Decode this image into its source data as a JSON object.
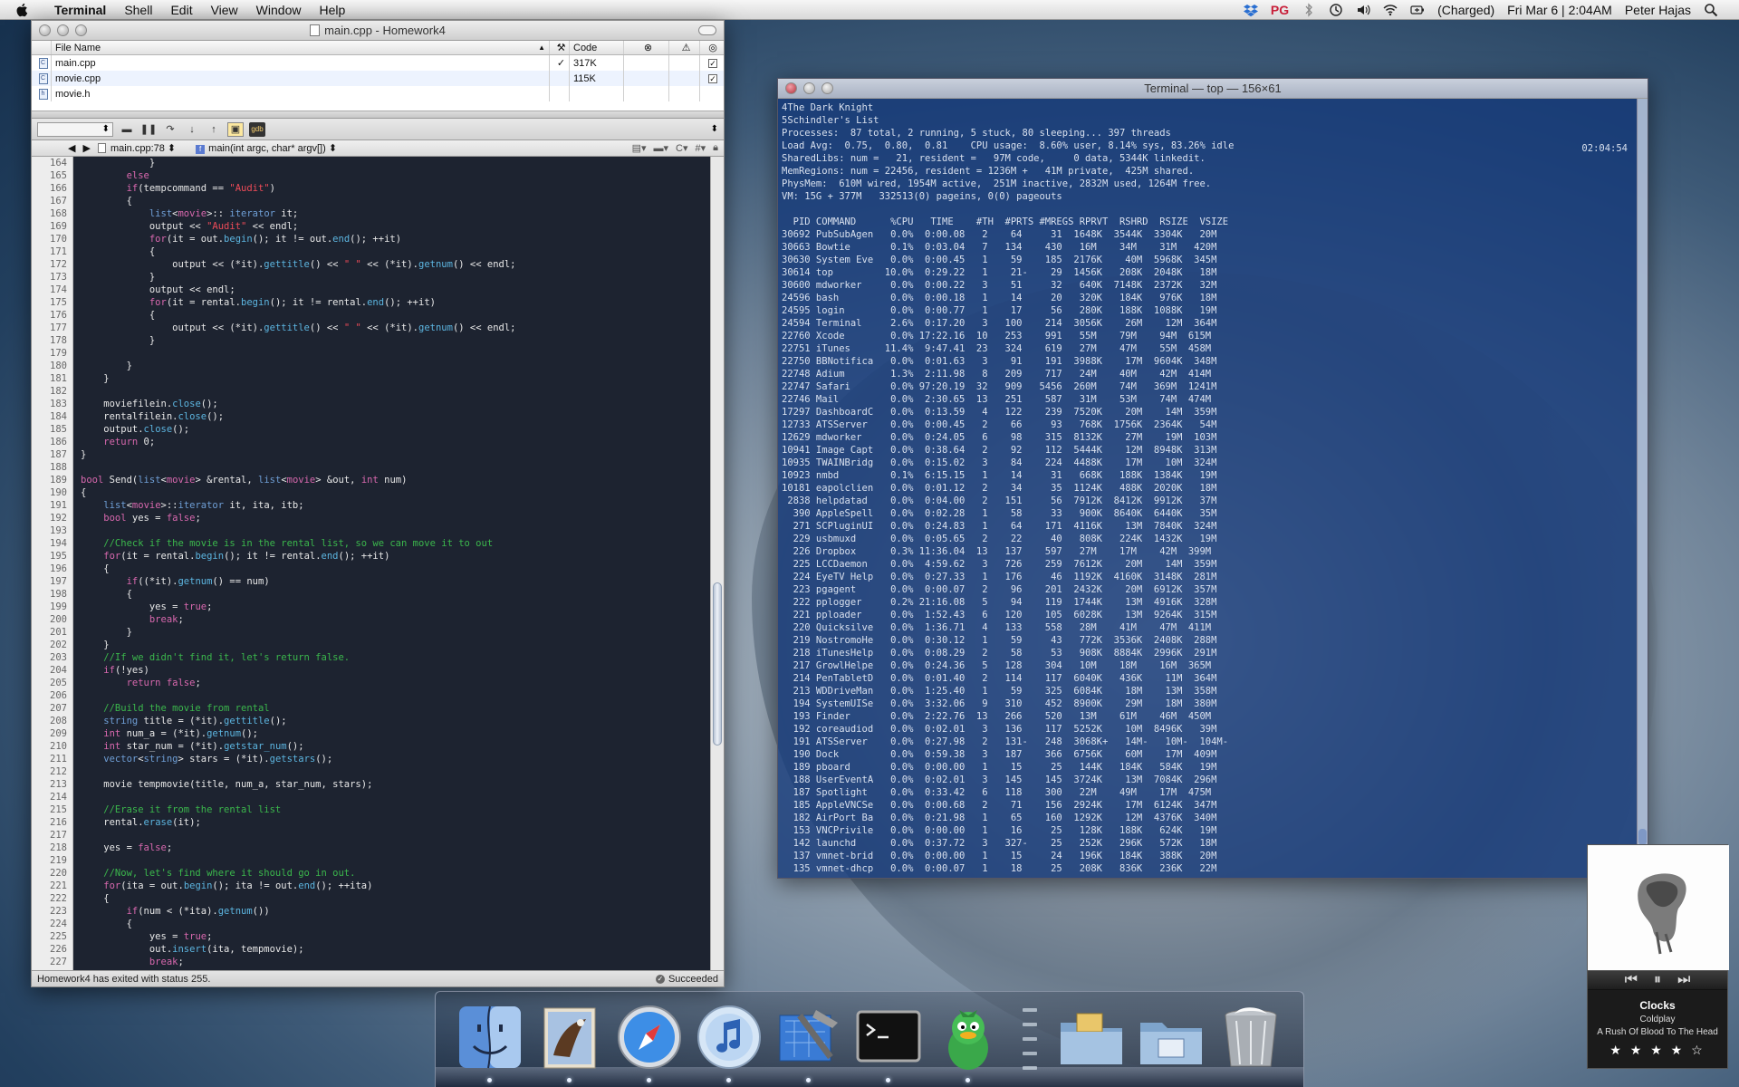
{
  "menubar": {
    "app_name": "Terminal",
    "menus": [
      "Shell",
      "Edit",
      "View",
      "Window",
      "Help"
    ],
    "battery": "(Charged)",
    "clock": "Fri Mar 6 | 2:04AM",
    "user": "Peter Hajas",
    "pg_label": "PG"
  },
  "xcode": {
    "title": "main.cpp - Homework4",
    "columns": {
      "file_name": "File Name",
      "code": "Code"
    },
    "files": [
      {
        "name": "main.cpp",
        "built": "✓",
        "code": "317K",
        "target": "✓"
      },
      {
        "name": "movie.cpp",
        "built": "",
        "code": "115K",
        "target": "✓"
      },
      {
        "name": "movie.h",
        "built": "",
        "code": "",
        "target": ""
      }
    ],
    "nav_file": "main.cpp:78",
    "nav_function": "main(int argc, char* argv[])",
    "status_left": "Homework4 has exited with status 255.",
    "status_right": "Succeeded",
    "gdb_label": "gdb",
    "line_numbers": [
      "164",
      "165",
      "166",
      "167",
      "168",
      "169",
      "170",
      "171",
      "172",
      "173",
      "174",
      "175",
      "176",
      "177",
      "178",
      "179",
      "180",
      "181",
      "182",
      "183",
      "184",
      "185",
      "186",
      "187",
      "188",
      "189",
      "190",
      "191",
      "192",
      "193",
      "194",
      "195",
      "196",
      "197",
      "198",
      "199",
      "200",
      "201",
      "202",
      "203",
      "204",
      "205",
      "206",
      "207",
      "208",
      "209",
      "210",
      "211",
      "212",
      "213",
      "214",
      "215",
      "216",
      "217",
      "218",
      "219",
      "220",
      "221",
      "222",
      "223",
      "224",
      "225",
      "226",
      "227",
      "228"
    ],
    "code_lines": [
      [
        [
          "",
          "            }"
        ]
      ],
      [
        [
          "kw",
          "        else"
        ]
      ],
      [
        [
          "kw",
          "        if"
        ],
        [
          "",
          "(tempcommand == "
        ],
        [
          "st",
          "\"Audit\""
        ],
        [
          "",
          ")"
        ]
      ],
      [
        [
          "",
          "        {"
        ]
      ],
      [
        [
          "",
          "            "
        ],
        [
          "ty",
          "list"
        ],
        [
          "",
          "<"
        ],
        [
          "kw",
          "movie"
        ],
        [
          "",
          ">:: "
        ],
        [
          "ty",
          "iterator"
        ],
        [
          "",
          " it;"
        ]
      ],
      [
        [
          "",
          "            output << "
        ],
        [
          "st",
          "\"Audit\""
        ],
        [
          "",
          " << endl;"
        ]
      ],
      [
        [
          "",
          "            "
        ],
        [
          "kw",
          "for"
        ],
        [
          "",
          "(it = out."
        ],
        [
          "fn",
          "begin"
        ],
        [
          "",
          "(); it != out."
        ],
        [
          "fn",
          "end"
        ],
        [
          "",
          "(); ++it)"
        ]
      ],
      [
        [
          "",
          "            {"
        ]
      ],
      [
        [
          "",
          "                output << (*it)."
        ],
        [
          "fn",
          "gettitle"
        ],
        [
          "",
          "() << "
        ],
        [
          "st",
          "\" \""
        ],
        [
          "",
          " << (*it)."
        ],
        [
          "fn",
          "getnum"
        ],
        [
          "",
          "() << endl;"
        ]
      ],
      [
        [
          "",
          "            }"
        ]
      ],
      [
        [
          "",
          "            output << endl;"
        ]
      ],
      [
        [
          "",
          "            "
        ],
        [
          "kw",
          "for"
        ],
        [
          "",
          "(it = rental."
        ],
        [
          "fn",
          "begin"
        ],
        [
          "",
          "(); it != rental."
        ],
        [
          "fn",
          "end"
        ],
        [
          "",
          "(); ++it)"
        ]
      ],
      [
        [
          "",
          "            {"
        ]
      ],
      [
        [
          "",
          "                output << (*it)."
        ],
        [
          "fn",
          "gettitle"
        ],
        [
          "",
          "() << "
        ],
        [
          "st",
          "\" \""
        ],
        [
          "",
          " << (*it)."
        ],
        [
          "fn",
          "getnum"
        ],
        [
          "",
          "() << endl;"
        ]
      ],
      [
        [
          "",
          "            }"
        ]
      ],
      [
        [
          "",
          ""
        ]
      ],
      [
        [
          "",
          "        }"
        ]
      ],
      [
        [
          "",
          "    }"
        ]
      ],
      [
        [
          "",
          ""
        ]
      ],
      [
        [
          "",
          "    moviefilein."
        ],
        [
          "fn",
          "close"
        ],
        [
          "",
          "();"
        ]
      ],
      [
        [
          "",
          "    rentalfilein."
        ],
        [
          "fn",
          "close"
        ],
        [
          "",
          "();"
        ]
      ],
      [
        [
          "",
          "    output."
        ],
        [
          "fn",
          "close"
        ],
        [
          "",
          "();"
        ]
      ],
      [
        [
          "kw",
          "    return "
        ],
        [
          "",
          "0;"
        ]
      ],
      [
        [
          "",
          "}"
        ]
      ],
      [
        [
          "",
          ""
        ]
      ],
      [
        [
          "kw",
          "bool"
        ],
        [
          "",
          " Send("
        ],
        [
          "ty",
          "list"
        ],
        [
          "",
          "<"
        ],
        [
          "kw",
          "movie"
        ],
        [
          "",
          "> &rental, "
        ],
        [
          "ty",
          "list"
        ],
        [
          "",
          "<"
        ],
        [
          "kw",
          "movie"
        ],
        [
          "",
          "> &out, "
        ],
        [
          "kw",
          "int"
        ],
        [
          "",
          " num)"
        ]
      ],
      [
        [
          "",
          "{"
        ]
      ],
      [
        [
          "",
          "    "
        ],
        [
          "ty",
          "list"
        ],
        [
          "",
          "<"
        ],
        [
          "kw",
          "movie"
        ],
        [
          "",
          ">::"
        ],
        [
          "ty",
          "iterator"
        ],
        [
          "",
          " it, ita, itb;"
        ]
      ],
      [
        [
          "kw",
          "    bool"
        ],
        [
          "",
          " yes = "
        ],
        [
          "kw",
          "false"
        ],
        [
          "",
          ";"
        ]
      ],
      [
        [
          "",
          ""
        ]
      ],
      [
        [
          "cm",
          "    //Check if the movie is in the rental list, so we can move it to out"
        ]
      ],
      [
        [
          "kw",
          "    for"
        ],
        [
          "",
          "(it = rental."
        ],
        [
          "fn",
          "begin"
        ],
        [
          "",
          "(); it != rental."
        ],
        [
          "fn",
          "end"
        ],
        [
          "",
          "(); ++it)"
        ]
      ],
      [
        [
          "",
          "    {"
        ]
      ],
      [
        [
          "kw",
          "        if"
        ],
        [
          "",
          "((*it)."
        ],
        [
          "fn",
          "getnum"
        ],
        [
          "",
          "() == num)"
        ]
      ],
      [
        [
          "",
          "        {"
        ]
      ],
      [
        [
          "",
          "            yes = "
        ],
        [
          "kw",
          "true"
        ],
        [
          "",
          ";"
        ]
      ],
      [
        [
          "kw",
          "            break"
        ],
        [
          "",
          ";"
        ]
      ],
      [
        [
          "",
          "        }"
        ]
      ],
      [
        [
          "",
          "    }"
        ]
      ],
      [
        [
          "cm",
          "    //If we didn't find it, let's return false."
        ]
      ],
      [
        [
          "kw",
          "    if"
        ],
        [
          "",
          "(!yes)"
        ]
      ],
      [
        [
          "kw",
          "        return false"
        ],
        [
          "",
          ";"
        ]
      ],
      [
        [
          "",
          ""
        ]
      ],
      [
        [
          "cm",
          "    //Build the movie from rental"
        ]
      ],
      [
        [
          "ty",
          "    string"
        ],
        [
          "",
          " title = (*it)."
        ],
        [
          "fn",
          "gettitle"
        ],
        [
          "",
          "();"
        ]
      ],
      [
        [
          "kw",
          "    int"
        ],
        [
          "",
          " num_a = (*it)."
        ],
        [
          "fn",
          "getnum"
        ],
        [
          "",
          "();"
        ]
      ],
      [
        [
          "kw",
          "    int"
        ],
        [
          "",
          " star_num = (*it)."
        ],
        [
          "fn",
          "getstar_num"
        ],
        [
          "",
          "();"
        ]
      ],
      [
        [
          "ty",
          "    vector"
        ],
        [
          "",
          "<"
        ],
        [
          "ty",
          "string"
        ],
        [
          "",
          "> stars = (*it)."
        ],
        [
          "fn",
          "getstars"
        ],
        [
          "",
          "();"
        ]
      ],
      [
        [
          "",
          ""
        ]
      ],
      [
        [
          "",
          "    movie tempmovie(title, num_a, star_num, stars);"
        ]
      ],
      [
        [
          "",
          ""
        ]
      ],
      [
        [
          "cm",
          "    //Erase it from the rental list"
        ]
      ],
      [
        [
          "",
          "    rental."
        ],
        [
          "fn",
          "erase"
        ],
        [
          "",
          "(it);"
        ]
      ],
      [
        [
          "",
          ""
        ]
      ],
      [
        [
          "",
          "    yes = "
        ],
        [
          "kw",
          "false"
        ],
        [
          "",
          ";"
        ]
      ],
      [
        [
          "",
          ""
        ]
      ],
      [
        [
          "cm",
          "    //Now, let's find where it should go in out."
        ]
      ],
      [
        [
          "kw",
          "    for"
        ],
        [
          "",
          "(ita = out."
        ],
        [
          "fn",
          "begin"
        ],
        [
          "",
          "(); ita != out."
        ],
        [
          "fn",
          "end"
        ],
        [
          "",
          "(); ++ita)"
        ]
      ],
      [
        [
          "",
          "    {"
        ]
      ],
      [
        [
          "kw",
          "        if"
        ],
        [
          "",
          "(num < (*ita)."
        ],
        [
          "fn",
          "getnum"
        ],
        [
          "",
          "())"
        ]
      ],
      [
        [
          "",
          "        {"
        ]
      ],
      [
        [
          "",
          "            yes = "
        ],
        [
          "kw",
          "true"
        ],
        [
          "",
          ";"
        ]
      ],
      [
        [
          "",
          "            out."
        ],
        [
          "fn",
          "insert"
        ],
        [
          "",
          "(ita, tempmovie);"
        ]
      ],
      [
        [
          "kw",
          "            break"
        ],
        [
          "",
          ";"
        ]
      ]
    ]
  },
  "terminal": {
    "title": "Terminal — top — 156×61",
    "clock": "02:04:54",
    "lines": [
      "4The Dark Knight",
      "5Schindler's List",
      "Processes:  87 total, 2 running, 5 stuck, 80 sleeping... 397 threads",
      "Load Avg:  0.75,  0.80,  0.81    CPU usage:  8.60% user, 8.14% sys, 83.26% idle",
      "SharedLibs: num =   21, resident =   97M code,     0 data, 5344K linkedit.",
      "MemRegions: num = 22456, resident = 1236M +   41M private,  425M shared.",
      "PhysMem:  610M wired, 1954M active,  251M inactive, 2832M used, 1264M free.",
      "VM: 15G + 377M   332513(0) pageins, 0(0) pageouts",
      "",
      "  PID COMMAND      %CPU   TIME    #TH  #PRTS #MREGS RPRVT  RSHRD  RSIZE  VSIZE",
      "30692 PubSubAgen   0.0%  0:00.08   2    64     31  1648K  3544K  3304K   20M",
      "30663 Bowtie       0.1%  0:03.04   7   134    430   16M    34M    31M   420M",
      "30630 System Eve   0.0%  0:00.45   1    59    185  2176K    40M  5968K  345M",
      "30614 top         10.0%  0:29.22   1    21-    29  1456K   208K  2048K   18M",
      "30600 mdworker     0.0%  0:00.22   3    51     32   640K  7148K  2372K   32M",
      "24596 bash         0.0%  0:00.18   1    14     20   320K   184K   976K   18M",
      "24595 login        0.0%  0:00.77   1    17     56   280K   188K  1088K   19M",
      "24594 Terminal     2.6%  0:17.20   3   100    214  3056K    26M    12M  364M",
      "22760 Xcode        0.0% 17:22.16  10   253    991   55M    79M    94M  615M",
      "22751 iTunes      11.4%  9:47.41  23   324    619   27M    47M    55M  458M",
      "22750 BBNotifica   0.0%  0:01.63   3    91    191  3988K    17M  9604K  348M",
      "22748 Adium        1.3%  2:11.98   8   209    717   24M    40M    42M  414M",
      "22747 Safari       0.0% 97:20.19  32   909   5456  260M    74M   369M  1241M",
      "22746 Mail         0.0%  2:30.65  13   251    587   31M    53M    74M  474M",
      "17297 DashboardC   0.0%  0:13.59   4   122    239  7520K    20M    14M  359M",
      "12733 ATSServer    0.0%  0:00.45   2    66     93   768K  1756K  2364K   54M",
      "12629 mdworker     0.0%  0:24.05   6    98    315  8132K    27M    19M  103M",
      "10941 Image Capt   0.0%  0:38.64   2    92    112  5444K    12M  8948K  313M",
      "10935 TWAINBridg   0.0%  0:15.02   3    84    224  4488K    17M    10M  324M",
      "10923 nmbd         0.1%  6:15.15   1    14     31   668K   188K  1384K   19M",
      "10181 eapolclien   0.0%  0:01.12   2    34     35  1124K   488K  2020K   18M",
      " 2838 helpdatad    0.0%  0:04.00   2   151     56  7912K  8412K  9912K   37M",
      "  390 AppleSpell   0.0%  0:02.28   1    58     33   900K  8640K  6440K   35M",
      "  271 SCPluginUI   0.0%  0:24.83   1    64    171  4116K    13M  7840K  324M",
      "  229 usbmuxd      0.0%  0:05.65   2    22     40   808K   224K  1432K   19M",
      "  226 Dropbox      0.3% 11:36.04  13   137    597   27M    17M    42M  399M",
      "  225 LCCDaemon    0.0%  4:59.62   3   726    259  7612K    20M    14M  359M",
      "  224 EyeTV Help   0.0%  0:27.33   1   176     46  1192K  4160K  3148K  281M",
      "  223 pgagent      0.0%  0:00.07   2    96    201  2432K    20M  6912K  357M",
      "  222 pplogger     0.2% 21:16.08   5    94    119  1744K    13M  4916K  328M",
      "  221 pploader     0.0%  1:52.43   6   120    105  6028K    13M  9264K  315M",
      "  220 Quicksilve   0.0%  1:36.71   4   133    558   28M    41M    47M  411M",
      "  219 NostromoHe   0.0%  0:30.12   1    59     43   772K  3536K  2408K  288M",
      "  218 iTunesHelp   0.0%  0:08.29   2    58     53   908K  8884K  2996K  291M",
      "  217 GrowlHelpe   0.0%  0:24.36   5   128    304   10M    18M    16M  365M",
      "  214 PenTabletD   0.0%  0:01.40   2   114    117  6040K   436K    11M  364M",
      "  213 WDDriveMan   0.0%  1:25.40   1    59    325  6084K    18M    13M  358M",
      "  194 SystemUISe   0.0%  3:32.06   9   310    452  8900K    29M    18M  380M",
      "  193 Finder       0.0%  2:22.76  13   266    520   13M    61M    46M  450M",
      "  192 coreaudiod   0.0%  0:02.01   3   136    117  5252K    10M  8496K   39M",
      "  191 ATSServer    0.0%  0:27.98   2   131-   248  3068K+   14M-   10M-  104M-",
      "  190 Dock         0.0%  0:59.38   3   187    366  6756K    60M    17M  409M",
      "  189 pboard       0.0%  0:00.00   1    15     25   144K   184K   584K   19M",
      "  188 UserEventA   0.0%  0:02.01   3   145    145  3724K    13M  7084K  296M",
      "  187 Spotlight    0.0%  0:33.42   6   118    300   22M    49M    17M  475M",
      "  185 AppleVNCSe   0.0%  0:00.68   2    71    156  2924K    17M  6124K  347M",
      "  182 AirPort Ba   0.0%  0:21.98   1    65    160  1292K    12M  4376K  340M",
      "  153 VNCPrivile   0.0%  0:00.00   1    16     25   128K   188K   624K   19M",
      "  142 launchd      0.0%  0:37.72   3   327-    25   252K   296K   572K   18M",
      "  137 vmnet-brid   0.0%  0:00.00   1    15     24   196K   184K   388K   20M",
      "  135 vmnet-dhcp   0.0%  0:00.07   1    18     25   208K   836K   236K   22M"
    ]
  },
  "itunes": {
    "track": "Clocks",
    "artist": "Coldplay",
    "album": "A Rush Of Blood To The Head",
    "rating": 4,
    "stars": "★ ★ ★ ★ ☆"
  },
  "dock": {
    "items": [
      "finder-icon",
      "mail-icon",
      "safari-icon",
      "itunes-icon",
      "xcode-icon",
      "terminal-icon",
      "adium-icon",
      "documents-stack-icon",
      "applications-stack-icon",
      "trash-icon"
    ]
  }
}
